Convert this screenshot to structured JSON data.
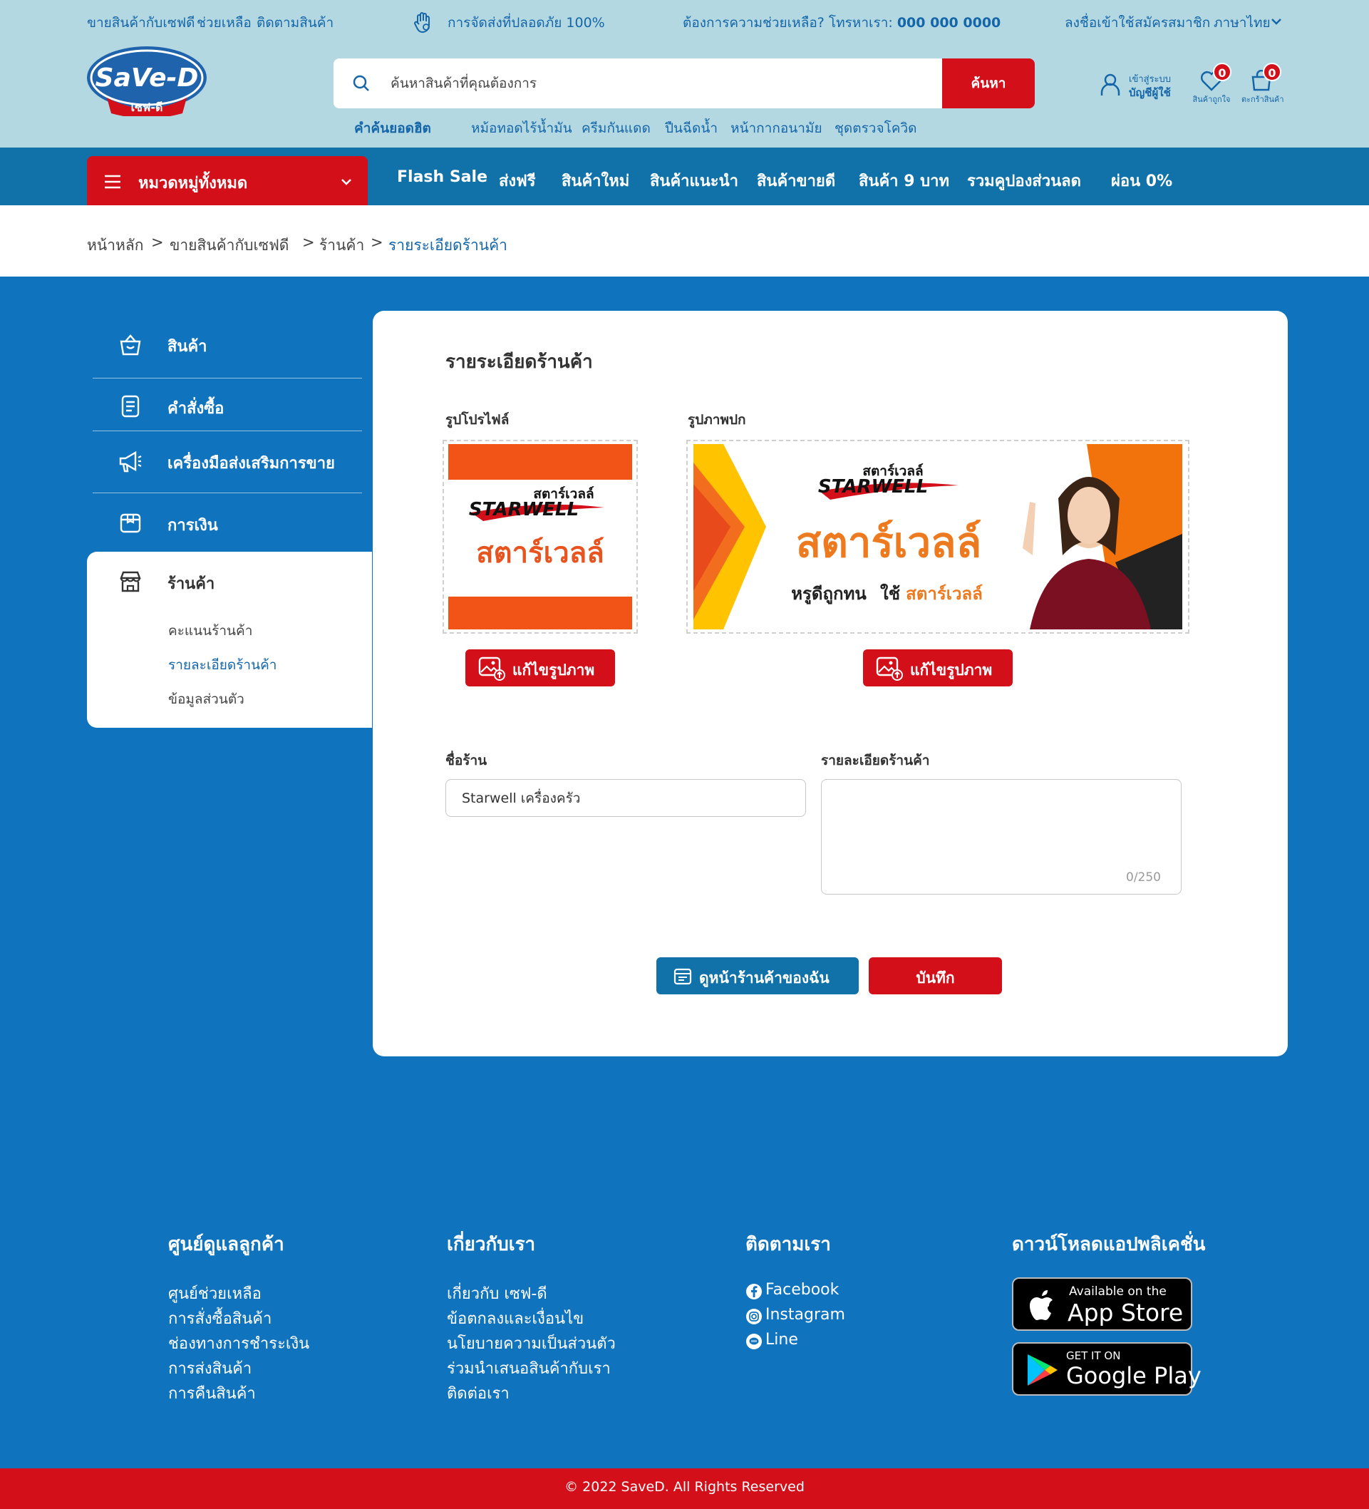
{
  "topbar": {
    "links": [
      "ขายสินค้ากับเซฟดี",
      "ช่วยเหลือ",
      "ติดตามสินค้า"
    ],
    "shipping": "การจัดส่งที่ปลอดภัย 100%",
    "help_text": "ต้องการความช่วยเหลือ? โทรหาเรา:",
    "phone": "000 000 0000",
    "right_links": [
      "ลงชื่อเข้าใช้",
      "สมัครสมาชิก",
      "ภาษาไทย"
    ]
  },
  "logo": {
    "text": "SaVe-D",
    "sub": "เซฟ-ดี"
  },
  "search": {
    "placeholder": "ค้นหาสินค้าที่คุณต้องการ",
    "button": "ค้นหา",
    "hot_label": "คำค้นยอดฮิต",
    "hot": [
      "หม้อทอดไร้น้ำมัน",
      "ครีมกันแดด",
      "ปืนฉีดน้ำ",
      "หน้ากากอนามัย",
      "ชุดตรวจโควิด"
    ]
  },
  "account": {
    "line1": "เข้าสู่ระบบ",
    "line2": "บัญชีผู้ใช้"
  },
  "wishlist": {
    "label": "สินค้าถูกใจ",
    "count": "0"
  },
  "cart": {
    "label": "ตะกร้าสินค้า",
    "count": "0"
  },
  "nav": {
    "category": "หมวดหมู่ทั้งหมด",
    "links": [
      "Flash Sale",
      "ส่งฟรี",
      "สินค้าใหม่",
      "สินค้าแนะนำ",
      "สินค้าขายดี",
      "สินค้า 9 บาท",
      "รวมคูปองส่วนลด",
      "ผ่อน 0%"
    ]
  },
  "breadcrumb": [
    "หน้าหลัก",
    "ขายสินค้ากับเซฟดี",
    "ร้านค้า",
    "รายระเอียดร้านค้า"
  ],
  "sidebar": {
    "items": [
      "สินค้า",
      "คำสั่งซื้อ",
      "เครื่องมือส่งเสริมการขาย",
      "การเงิน",
      "ร้านค้า"
    ],
    "sub_items": [
      "คะแนนร้านค้า",
      "รายละเอียดร้านค้า",
      "ข้อมูลส่วนตัว"
    ]
  },
  "main": {
    "title": "รายระเอียดร้านค้า",
    "profile_label": "รูปโปรไฟล์",
    "cover_label": "รูปภาพปก",
    "edit_button": "แก้ไขรูปภาพ",
    "profile_image": {
      "brand_th": "สตาร์เวลล์",
      "brand_en": "STARWELL",
      "name_th": "สตาร์เวลล์"
    },
    "cover_image": {
      "brand_th": "สตาร์เวลล์",
      "brand_en": "STARWELL",
      "name_th": "สตาร์เวลล์",
      "slogan": "หรูดีถูกทน",
      "slogan2": "ใช้",
      "slogan3": "สตาร์เวลล์"
    },
    "shop_name_label": "ชื่อร้าน",
    "shop_name_value": "Starwell เครื่องครัว",
    "shop_desc_label": "รายละเอียดร้านค้า",
    "shop_desc_value": "",
    "counter": "0/250",
    "view_button": "ดูหน้าร้านค้าของฉัน",
    "save_button": "บันทึก"
  },
  "footer": {
    "support": {
      "title": "ศูนย์ดูแลลูกค้า",
      "links": [
        "ศูนย์ช่วยเหลือ",
        "การสั่งซื้อสินค้า",
        "ช่องทางการชำระเงิน",
        "การส่งสินค้า",
        "การคืนสินค้า"
      ]
    },
    "about": {
      "title": "เกี่ยวกับเรา",
      "links": [
        "เกี่ยวกับ เซฟ-ดี",
        "ข้อตกลงและเงื่อนไข",
        "นโยบายความเป็นส่วนตัว",
        "ร่วมนำเสนอสินค้ากับเรา",
        "ติดต่อเรา"
      ]
    },
    "follow": {
      "title": "ติดตามเรา",
      "links": [
        "Facebook",
        "Instagram",
        "Line"
      ]
    },
    "app": {
      "title": "ดาวน์โหลดแอปพลิเคชั่น",
      "appstore_small": "Available on the",
      "appstore_big": "App Store",
      "google_small": "GET IT ON",
      "google_big": "Google Play"
    },
    "copyright": "© 2022 SaveD. All Rights Reserved"
  },
  "colors": {
    "brand_red": "#d3101a",
    "brand_blue": "#1072a8",
    "page_blue": "#0f73bd",
    "top_bg": "#b3d8e2"
  }
}
